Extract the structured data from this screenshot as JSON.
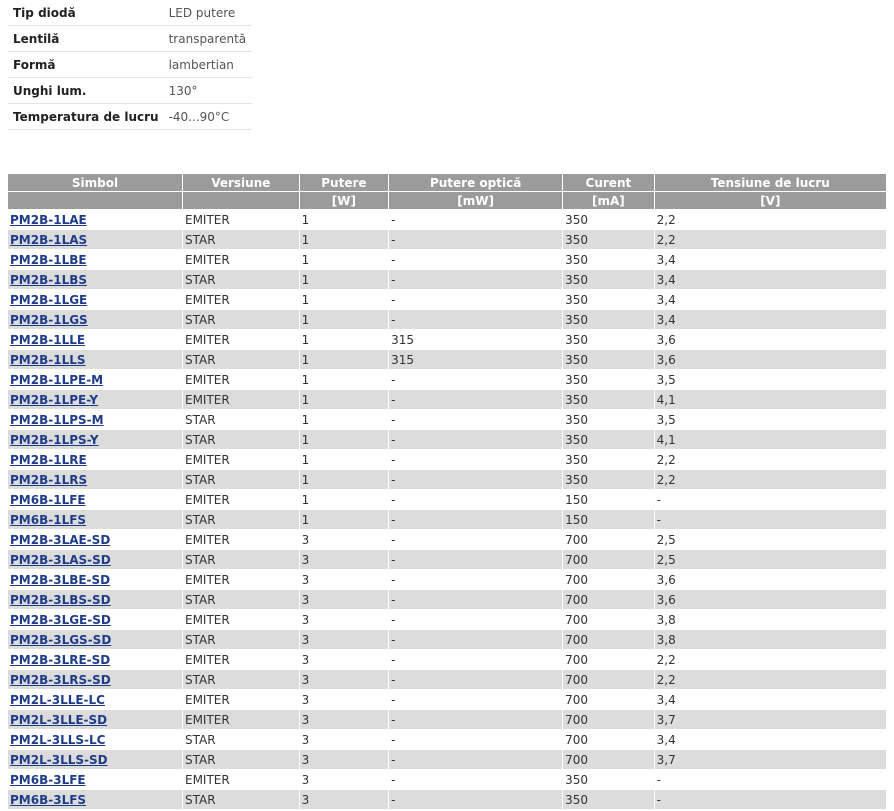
{
  "specs": [
    {
      "label": "Tip diodă",
      "value": "LED putere"
    },
    {
      "label": "Lentilă",
      "value": "transparentă"
    },
    {
      "label": "Formă",
      "value": "lambertian"
    },
    {
      "label": "Unghi lum.",
      "value": "130°"
    },
    {
      "label": "Temperatura de lucru",
      "value": "-40...90°C"
    }
  ],
  "table": {
    "headers": [
      "Simbol",
      "Versiune",
      "Putere",
      "Putere optică",
      "Curent",
      "Tensiune de lucru"
    ],
    "units": [
      "",
      "",
      "[W]",
      "[mW]",
      "[mA]",
      "[V]"
    ],
    "rows": [
      [
        "PM2B-1LAE",
        "EMITER",
        "1",
        "-",
        "350",
        "2,2"
      ],
      [
        "PM2B-1LAS",
        "STAR",
        "1",
        "-",
        "350",
        "2,2"
      ],
      [
        "PM2B-1LBE",
        "EMITER",
        "1",
        "-",
        "350",
        "3,4"
      ],
      [
        "PM2B-1LBS",
        "STAR",
        "1",
        "-",
        "350",
        "3,4"
      ],
      [
        "PM2B-1LGE",
        "EMITER",
        "1",
        "-",
        "350",
        "3,4"
      ],
      [
        "PM2B-1LGS",
        "STAR",
        "1",
        "-",
        "350",
        "3,4"
      ],
      [
        "PM2B-1LLE",
        "EMITER",
        "1",
        "315",
        "350",
        "3,6"
      ],
      [
        "PM2B-1LLS",
        "STAR",
        "1",
        "315",
        "350",
        "3,6"
      ],
      [
        "PM2B-1LPE-M",
        "EMITER",
        "1",
        "-",
        "350",
        "3,5"
      ],
      [
        "PM2B-1LPE-Y",
        "EMITER",
        "1",
        "-",
        "350",
        "4,1"
      ],
      [
        "PM2B-1LPS-M",
        "STAR",
        "1",
        "-",
        "350",
        "3,5"
      ],
      [
        "PM2B-1LPS-Y",
        "STAR",
        "1",
        "-",
        "350",
        "4,1"
      ],
      [
        "PM2B-1LRE",
        "EMITER",
        "1",
        "-",
        "350",
        "2,2"
      ],
      [
        "PM2B-1LRS",
        "STAR",
        "1",
        "-",
        "350",
        "2,2"
      ],
      [
        "PM6B-1LFE",
        "EMITER",
        "1",
        "-",
        "150",
        "-"
      ],
      [
        "PM6B-1LFS",
        "STAR",
        "1",
        "-",
        "150",
        "-"
      ],
      [
        "PM2B-3LAE-SD",
        "EMITER",
        "3",
        "-",
        "700",
        "2,5"
      ],
      [
        "PM2B-3LAS-SD",
        "STAR",
        "3",
        "-",
        "700",
        "2,5"
      ],
      [
        "PM2B-3LBE-SD",
        "EMITER",
        "3",
        "-",
        "700",
        "3,6"
      ],
      [
        "PM2B-3LBS-SD",
        "STAR",
        "3",
        "-",
        "700",
        "3,6"
      ],
      [
        "PM2B-3LGE-SD",
        "EMITER",
        "3",
        "-",
        "700",
        "3,8"
      ],
      [
        "PM2B-3LGS-SD",
        "STAR",
        "3",
        "-",
        "700",
        "3,8"
      ],
      [
        "PM2B-3LRE-SD",
        "EMITER",
        "3",
        "-",
        "700",
        "2,2"
      ],
      [
        "PM2B-3LRS-SD",
        "STAR",
        "3",
        "-",
        "700",
        "2,2"
      ],
      [
        "PM2L-3LLE-LC",
        "EMITER",
        "3",
        "-",
        "700",
        "3,4"
      ],
      [
        "PM2L-3LLE-SD",
        "EMITER",
        "3",
        "-",
        "700",
        "3,7"
      ],
      [
        "PM2L-3LLS-LC",
        "STAR",
        "3",
        "-",
        "700",
        "3,4"
      ],
      [
        "PM2L-3LLS-SD",
        "STAR",
        "3",
        "-",
        "700",
        "3,7"
      ],
      [
        "PM6B-3LFE",
        "EMITER",
        "3",
        "-",
        "350",
        "-"
      ],
      [
        "PM6B-3LFS",
        "STAR",
        "3",
        "-",
        "350",
        "-"
      ]
    ]
  }
}
